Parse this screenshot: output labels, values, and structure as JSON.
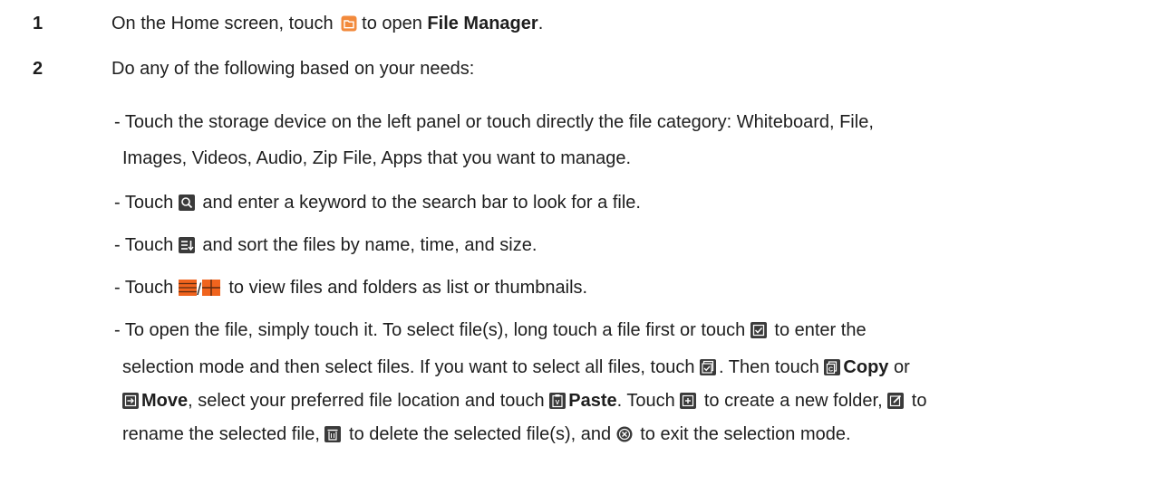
{
  "steps": [
    {
      "number": "1",
      "parts": {
        "pre": "On the Home screen, touch",
        "mid": " to open ",
        "bold": "File Manager",
        "post": "."
      }
    },
    {
      "number": "2",
      "text": "Do any of the following based on your needs:"
    }
  ],
  "bullets": {
    "storage_l1": "- Touch the storage device on the left panel or touch directly the file category: Whiteboard, File,",
    "storage_l2": "Images, Videos, Audio, Zip File, Apps that you want to manage.",
    "search_pre": "- Touch ",
    "search_post": " and enter a keyword to the search bar to look for a file.",
    "sort_pre": "- Touch ",
    "sort_post": " and sort the files by name, time, and size.",
    "view_pre": "- Touch ",
    "view_post": " to view files and folders as list or thumbnails.",
    "open_l1_pre": "- To open the file, simply touch it. To select file(s), long touch a file first or touch ",
    "open_l1_post": " to enter the",
    "open_l2_pre": "selection mode and then select files. If you want to select all files, touch ",
    "open_l2_mid": ". Then touch ",
    "copy_label": "Copy",
    "open_l2_post": " or",
    "move_label": "Move",
    "open_l3_mid": ", select your preferred file location and touch ",
    "paste_label": "Paste",
    "open_l3_mid2": ". Touch ",
    "open_l3_post": " to create a new folder, ",
    "open_l3_end": " to",
    "open_l4_pre": "rename the selected file, ",
    "open_l4_mid": " to delete the selected file(s), and ",
    "open_l4_post": " to exit the selection mode."
  },
  "icons": {
    "file_manager": "file-manager-icon",
    "search": "search-icon",
    "sort": "sort-icon",
    "list_view": "list-view-icon",
    "thumbnail_view": "thumbnail-view-icon",
    "select": "select-checkbox-icon",
    "select_all": "select-all-icon",
    "copy": "copy-icon",
    "move": "move-icon",
    "paste": "paste-icon",
    "new_folder": "new-folder-icon",
    "rename": "rename-icon",
    "delete": "delete-icon",
    "exit": "exit-selection-icon"
  },
  "colors": {
    "text": "#1e1e1e",
    "icon_dark": "#3a3a3a",
    "icon_orange": "#f0641e",
    "file_manager_orange": "#f28a3c"
  }
}
